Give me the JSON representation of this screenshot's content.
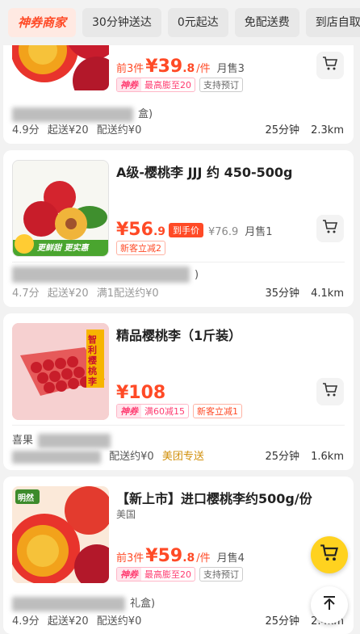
{
  "filters": [
    {
      "label": "神券商家",
      "brand": true
    },
    {
      "label": "30分钟送达"
    },
    {
      "label": "0元起达"
    },
    {
      "label": "免配送费"
    },
    {
      "label": "到店自取"
    }
  ],
  "items": [
    {
      "pre": "前3件",
      "price_int": "¥39",
      "price_dec": ".8",
      "unit": "/件",
      "sold": "月售3",
      "badges": [
        {
          "type": "shenquan",
          "label": "神券",
          "text": "最高膨至20"
        },
        {
          "type": "grey",
          "text": "支持预订"
        }
      ],
      "shop_name_visible": "盒)",
      "shop_stats": [
        "4.9分",
        "起送¥20",
        "配送约¥0"
      ],
      "delivery": [
        "25分钟",
        "2.3km"
      ]
    },
    {
      "title": "A级-樱桃李 JJJ 约 450-500g",
      "price_int": "¥56",
      "price_dec": ".9",
      "arrival": "到手价",
      "orig": "¥76.9",
      "sold": "月售1",
      "badges": [
        {
          "type": "red",
          "text": "新客立减2"
        }
      ],
      "shop_name_visible": ")",
      "shop_stats": [
        "4.7分",
        "起送¥20",
        "满1配送约¥0"
      ],
      "delivery": [
        "35分钟",
        "4.1km"
      ],
      "image_text": [
        "更鲜甜",
        "更实惠"
      ]
    },
    {
      "title": "精品樱桃李（1斤装）",
      "price_int": "¥108",
      "badges": [
        {
          "type": "shenquan",
          "label": "神券",
          "text": "满60减15"
        },
        {
          "type": "red",
          "text": "新客立减1"
        }
      ],
      "shop_name_visible": "喜果",
      "shop_stats": [
        "配送约¥0"
      ],
      "meituan": "美团专送",
      "delivery": [
        "25分钟",
        "1.6km"
      ],
      "image_text": "智利樱桃李"
    },
    {
      "title": "【新上市】进口樱桃李约500g/份",
      "origin": "美国",
      "pre": "前3件",
      "price_int": "¥59",
      "price_dec": ".8",
      "unit": "/件",
      "sold": "月售4",
      "badges": [
        {
          "type": "shenquan",
          "label": "神券",
          "text": "最高膨至20"
        },
        {
          "type": "grey",
          "text": "支持预订"
        }
      ],
      "shop_name_visible": "礼盒)",
      "shop_stats": [
        "4.9分",
        "起送¥20",
        "配送约¥0"
      ],
      "delivery": [
        "25分钟",
        "2.4km"
      ],
      "image_text": "明然"
    }
  ],
  "icons": {
    "cart": "cart-icon",
    "back_top": "arrow-up-icon"
  },
  "colors": {
    "accent": "#ff4a26",
    "shenquan": "#ff3b70",
    "fab": "#ffd21f",
    "meituan": "#d18f0a"
  }
}
